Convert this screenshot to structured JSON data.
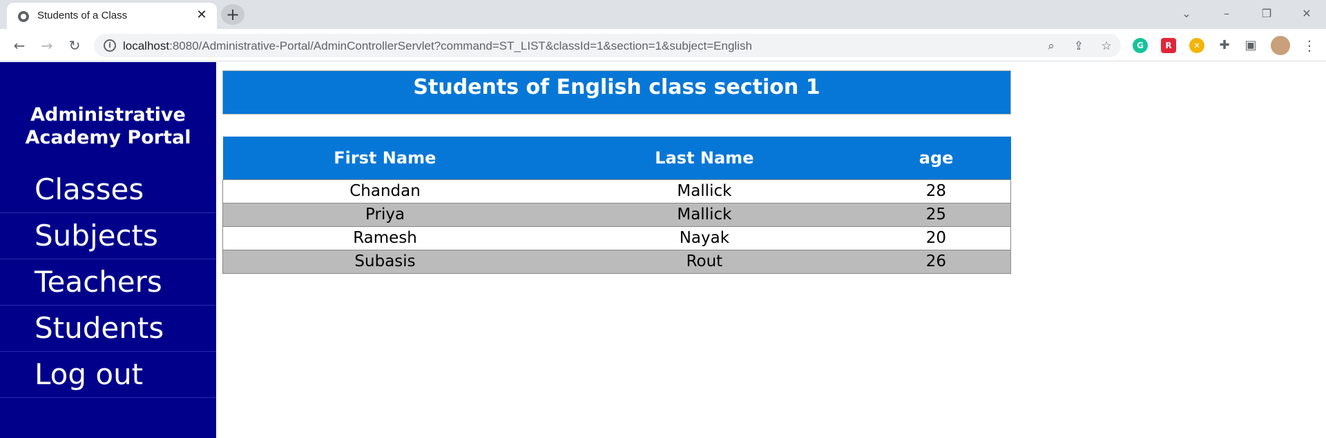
{
  "browser": {
    "tab_title": "Students of a Class",
    "url_host": "localhost",
    "url_rest": ":8080/Administrative-Portal/AdminControllerServlet?command=ST_LIST&classId=1&section=1&subject=English"
  },
  "sidebar": {
    "brand_line1": "Administrative",
    "brand_line2": "Academy Portal",
    "items": [
      {
        "label": "Classes"
      },
      {
        "label": "Subjects"
      },
      {
        "label": "Teachers"
      },
      {
        "label": "Students"
      },
      {
        "label": "Log out"
      }
    ]
  },
  "main": {
    "heading": "Students of English class section 1",
    "table": {
      "headers": [
        "First Name",
        "Last Name",
        "age"
      ],
      "rows": [
        [
          "Chandan",
          "Mallick",
          "28"
        ],
        [
          "Priya",
          "Mallick",
          "25"
        ],
        [
          "Ramesh",
          "Nayak",
          "20"
        ],
        [
          "Subasis",
          "Rout",
          "26"
        ]
      ]
    }
  },
  "colors": {
    "sidebar_bg": "#00008b",
    "header_blue": "#0777d7",
    "alt_row": "#bbbbbb"
  }
}
